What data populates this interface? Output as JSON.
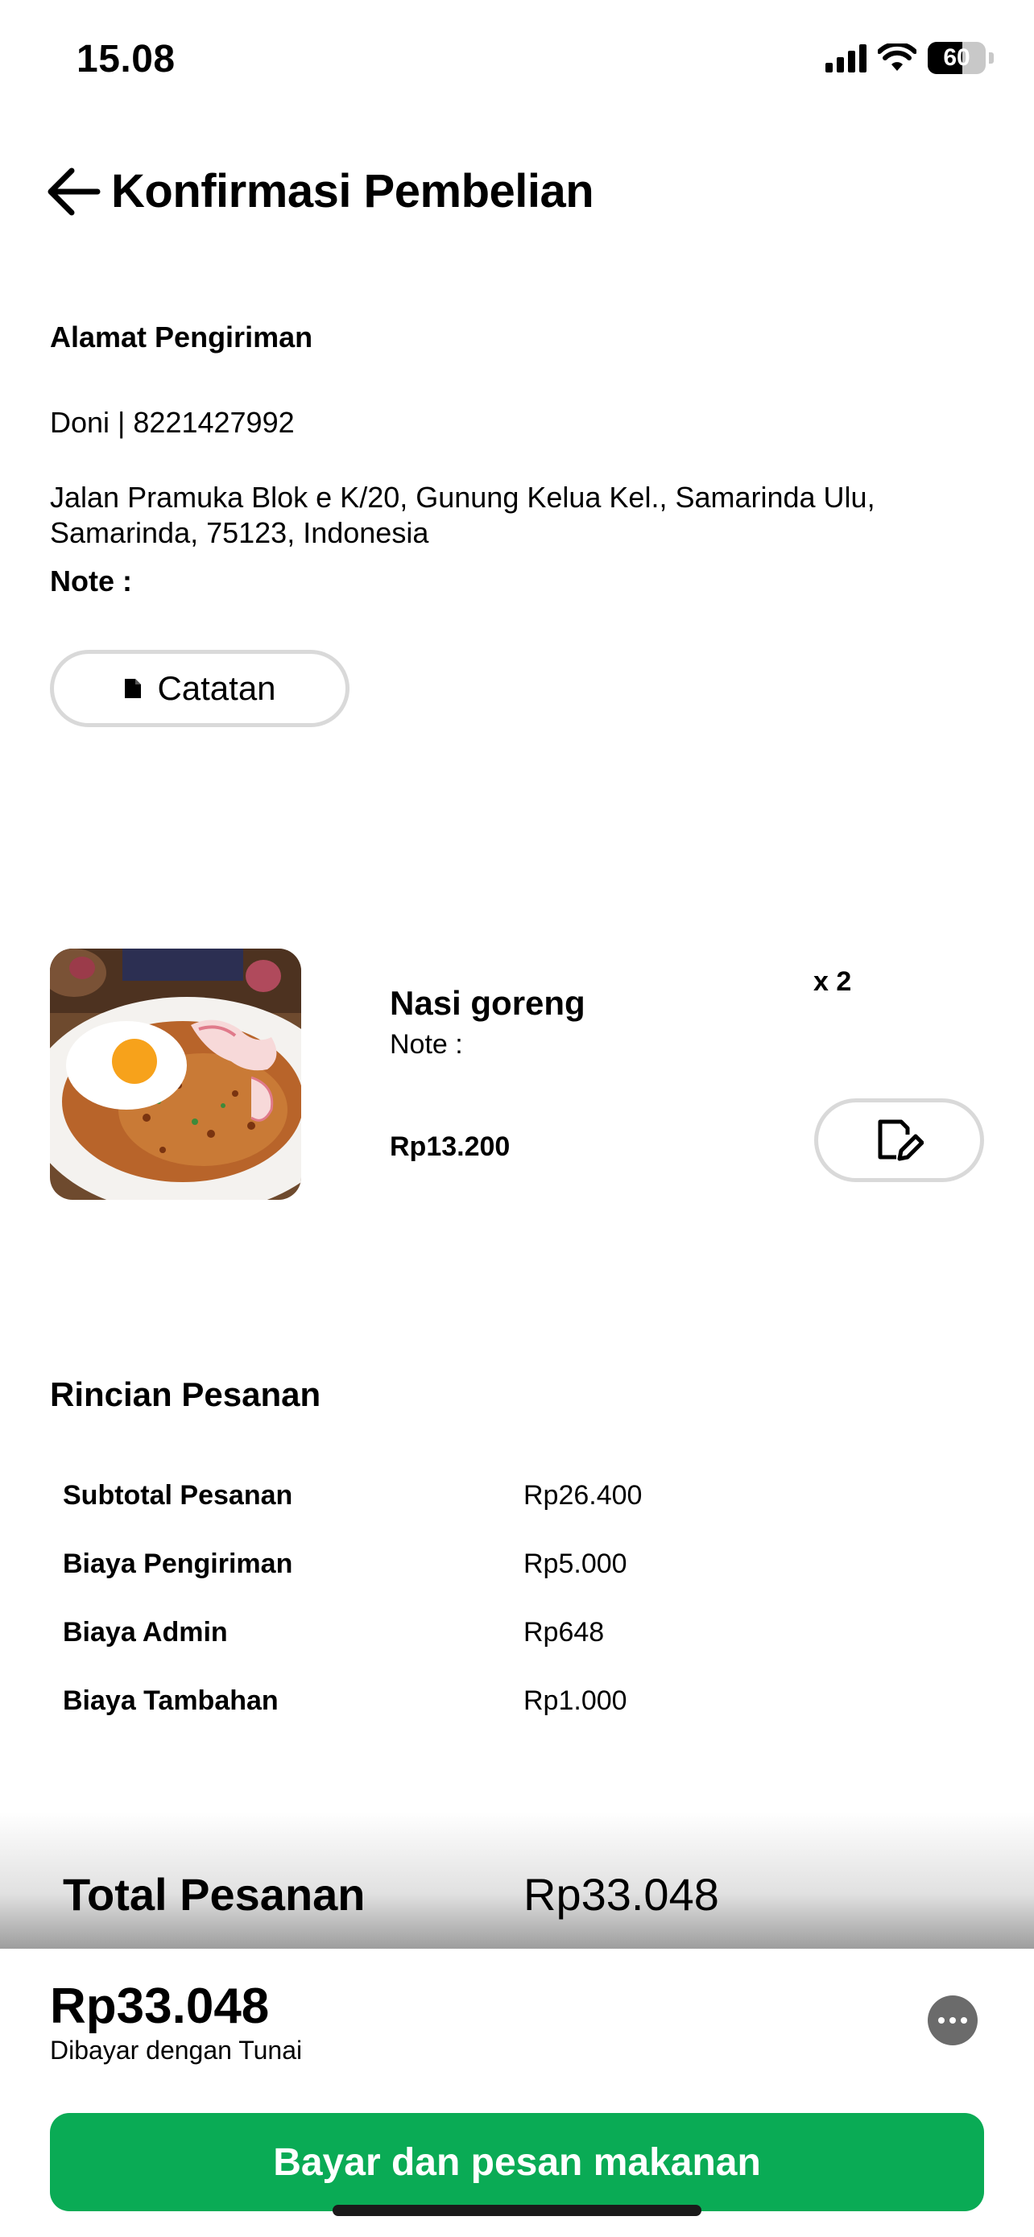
{
  "status_bar": {
    "time": "15.08",
    "battery": "60",
    "battery_level": 0.6
  },
  "header": {
    "title": "Konfirmasi Pembelian"
  },
  "address": {
    "label": "Alamat Pengiriman",
    "contact": "Doni | 8221427992",
    "line1": "Jalan Pramuka Blok e K/20, Gunung Kelua Kel., Samarinda Ulu,",
    "line2": "Samarinda, 75123, Indonesia",
    "note_label": "Note :",
    "note_button": "Catatan"
  },
  "product": {
    "name": "Nasi goreng",
    "note": "Note :",
    "price": "Rp13.200",
    "quantity": "x 2"
  },
  "details": {
    "title": "Rincian Pesanan",
    "rows": [
      {
        "label": "Subtotal Pesanan",
        "value": "Rp26.400"
      },
      {
        "label": "Biaya Pengiriman",
        "value": "Rp5.000"
      },
      {
        "label": "Biaya Admin",
        "value": "Rp648"
      },
      {
        "label": "Biaya Tambahan",
        "value": "Rp1.000"
      }
    ],
    "total_label": "Total Pesanan",
    "total_value": "Rp33.048"
  },
  "payment": {
    "amount": "Rp33.048",
    "method": "Dibayar dengan Tunai",
    "button": "Bayar dan pesan makanan"
  },
  "colors": {
    "primary": "#0aab55"
  }
}
